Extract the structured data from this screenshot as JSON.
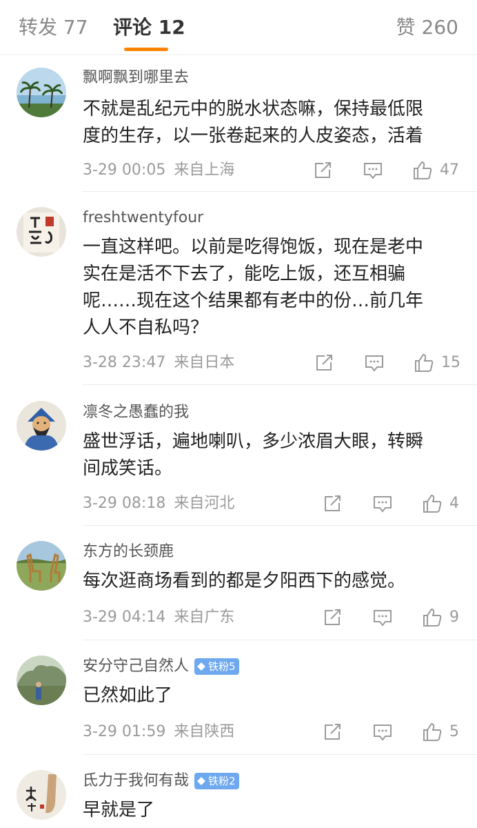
{
  "tabs": {
    "repost": "转发 77",
    "comments": "评论 12",
    "likes": "赞 260"
  },
  "colors": {
    "accent": "#ff8200",
    "badge": "#6ea8ee",
    "meta_text": "#9a9a9a"
  },
  "comments": [
    {
      "username": "飘啊飘到哪里去",
      "lines": [
        "不就是乱纪元中的脱水状态嘛，保持最低限",
        "度的生存，以一张卷起来的人皮姿态，活着"
      ],
      "time": "3-29 00:05",
      "location": "来自上海",
      "likes": "47",
      "avatar_icon": "palm-beach-avatar-icon"
    },
    {
      "username": "freshtwentyfour",
      "lines": [
        "一直这样吧。以前是吃得饱饭，现在是老中",
        "实在是活不下去了，能吃上饭，还互相骗",
        "呢……现在这个结果都有老中的份…前几年",
        "人人不自私吗？"
      ],
      "time": "3-28 23:47",
      "location": "来自日本",
      "likes": "15",
      "avatar_icon": "calligraphy-avatar-icon"
    },
    {
      "username": "凛冬之愚蠢的我",
      "lines": [
        "盛世浮话，遍地喇叭，多少浓眉大眼，转瞬",
        "间成笑话。"
      ],
      "time": "3-29 08:18",
      "location": "来自河北",
      "likes": "4",
      "avatar_icon": "sage-portrait-avatar-icon"
    },
    {
      "username": "东方的长颈鹿",
      "lines": [
        "每次逛商场看到的都是夕阳西下的感觉。"
      ],
      "time": "3-29 04:14",
      "location": "来自广东",
      "likes": "9",
      "avatar_icon": "giraffe-avatar-icon"
    },
    {
      "username": "安分守己自然人",
      "badge": "铁粉5",
      "lines": [
        "已然如此了"
      ],
      "time": "3-29 01:59",
      "location": "来自陕西",
      "likes": "5",
      "avatar_icon": "garden-avatar-icon"
    },
    {
      "username": "氐力于我何有哉",
      "badge": "铁粉2",
      "lines": [
        "早就是了"
      ],
      "avatar_icon": "ink-calligraphy-avatar-icon"
    }
  ]
}
